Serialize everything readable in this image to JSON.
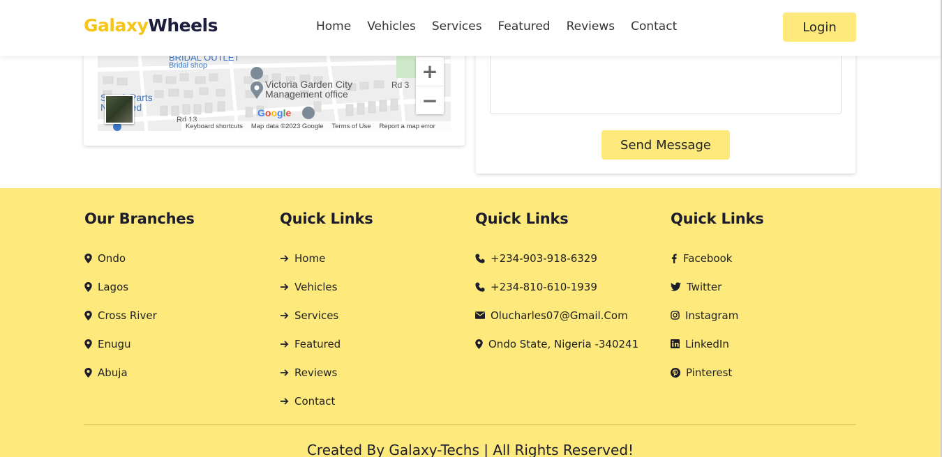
{
  "header": {
    "logo_part1": "Galaxy",
    "logo_part2": "Wheels",
    "nav": [
      "Home",
      "Vehicles",
      "Services",
      "Featured",
      "Reviews",
      "Contact"
    ],
    "login_label": "Login"
  },
  "map": {
    "labels": {
      "bridal_outlet": "BRIDAL OUTLET",
      "bridal_shop": "Bridal shop",
      "place_line1": "Victoria Garden City",
      "place_line2": "Management office",
      "rd3": "Rd 3",
      "rd13": "Rd 13",
      "spares1": "S   rs & Parts",
      "spares2": "N   Limited",
      "google": "Google"
    },
    "zoom_in": "+",
    "zoom_out": "−",
    "attribution": [
      "Keyboard shortcuts",
      "Map data ©2023 Google",
      "Terms of Use",
      "Report a map error"
    ]
  },
  "contact_form": {
    "message_value": "",
    "send_label": "Send Message"
  },
  "footer": {
    "branches": {
      "title": "Our Branches",
      "items": [
        "Ondo",
        "Lagos",
        "Cross River",
        "Enugu",
        "Abuja"
      ]
    },
    "quick_links": {
      "title": "Quick Links",
      "items": [
        "Home",
        "Vehicles",
        "Services",
        "Featured",
        "Reviews",
        "Contact"
      ]
    },
    "contact": {
      "title": "Quick Links",
      "phone1": "+234-903-918-6329",
      "phone2": "+234-810-610-1939",
      "email": "Olucharles07@Gmail.Com",
      "address": "Ondo State, Nigeria -340241"
    },
    "social": {
      "title": "Quick Links",
      "items": [
        {
          "label": "Facebook",
          "icon": "facebook-icon"
        },
        {
          "label": "Twitter",
          "icon": "twitter-icon"
        },
        {
          "label": "Instagram",
          "icon": "instagram-icon"
        },
        {
          "label": "LinkedIn",
          "icon": "linkedin-icon"
        },
        {
          "label": "Pinterest",
          "icon": "pinterest-icon"
        }
      ]
    },
    "credit": "Created By Galaxy-Techs | All Rights Reserved!"
  },
  "colors": {
    "accent_yellow": "#fde97c",
    "logo_yellow": "#f5c518",
    "logo_dark": "#1c1c3c"
  }
}
